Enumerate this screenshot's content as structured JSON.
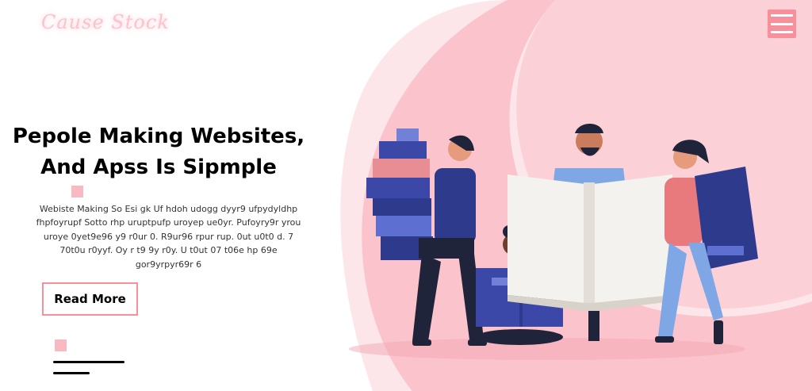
{
  "brand": {
    "logo_text": "Cause Stock",
    "accent_color": "#f7909b"
  },
  "nav": {
    "menu_icon": "hamburger-menu-icon"
  },
  "hero": {
    "headline_line1": "Pepole Making Websites,",
    "headline_line2": "And Apss Is Sipmple",
    "description": "Webiste Making So Esi gk Uf hdoh udogg dyyr9 ufpydyldhp fhpfoyrupf Sotto rhp uruptpufp uroyep ue0yr. Pufoyry9r yrou uroye 0yet9e96 y9 r0ur 0. R9ur96 rpur rup. 0ut u0t0 d. 7 70t0u r0yyf. Oy r t9 9y r0y. U t0ut 07 t06e hp 69e gor9yrpyr69r 6",
    "cta_label": "Read More"
  },
  "illustration": {
    "name": "people-with-books-illustration"
  },
  "colors": {
    "pink_blob": "#fbc7cf",
    "light_pink": "#fde4e8",
    "navy": "#2e3a8c",
    "headline": "#000000"
  }
}
